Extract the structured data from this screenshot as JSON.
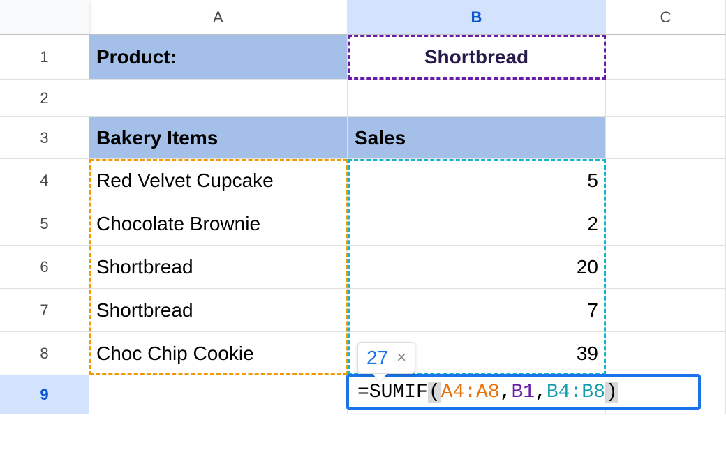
{
  "columns": {
    "A": "A",
    "B": "B",
    "C": "C"
  },
  "rows": {
    "1": "1",
    "2": "2",
    "3": "3",
    "4": "4",
    "5": "5",
    "6": "6",
    "7": "7",
    "8": "8",
    "9": "9"
  },
  "cells": {
    "A1": "Product:",
    "B1": "Shortbread",
    "A3": "Bakery Items",
    "B3": "Sales",
    "A4": "Red Velvet Cupcake",
    "B4": "5",
    "A5": "Chocolate Brownie",
    "B5": "2",
    "A6": "Shortbread",
    "B6": "20",
    "A7": "Shortbread",
    "B7": "7",
    "A8": "Choc Chip Cookie",
    "B8": "39"
  },
  "formula": {
    "prefix": "=",
    "fn": "SUMIF",
    "open": "(",
    "arg1": "A4:A8",
    "sep": ",",
    "arg2": "B1",
    "arg3": "B4:B8",
    "close": ")",
    "result": "27",
    "close_glyph": "×"
  },
  "ranges": {
    "criteria_range": "A4:A8",
    "criteria_cell": "B1",
    "sum_range": "B4:B8"
  },
  "active_cell": "B9",
  "chart_data": {
    "type": "table",
    "title": "Bakery Items Sales",
    "columns": [
      "Bakery Items",
      "Sales"
    ],
    "rows": [
      [
        "Red Velvet Cupcake",
        5
      ],
      [
        "Chocolate Brownie",
        2
      ],
      [
        "Shortbread",
        20
      ],
      [
        "Shortbread",
        7
      ],
      [
        "Choc Chip Cookie",
        39
      ]
    ],
    "lookup": {
      "product": "Shortbread",
      "sumif_result": 27
    }
  }
}
